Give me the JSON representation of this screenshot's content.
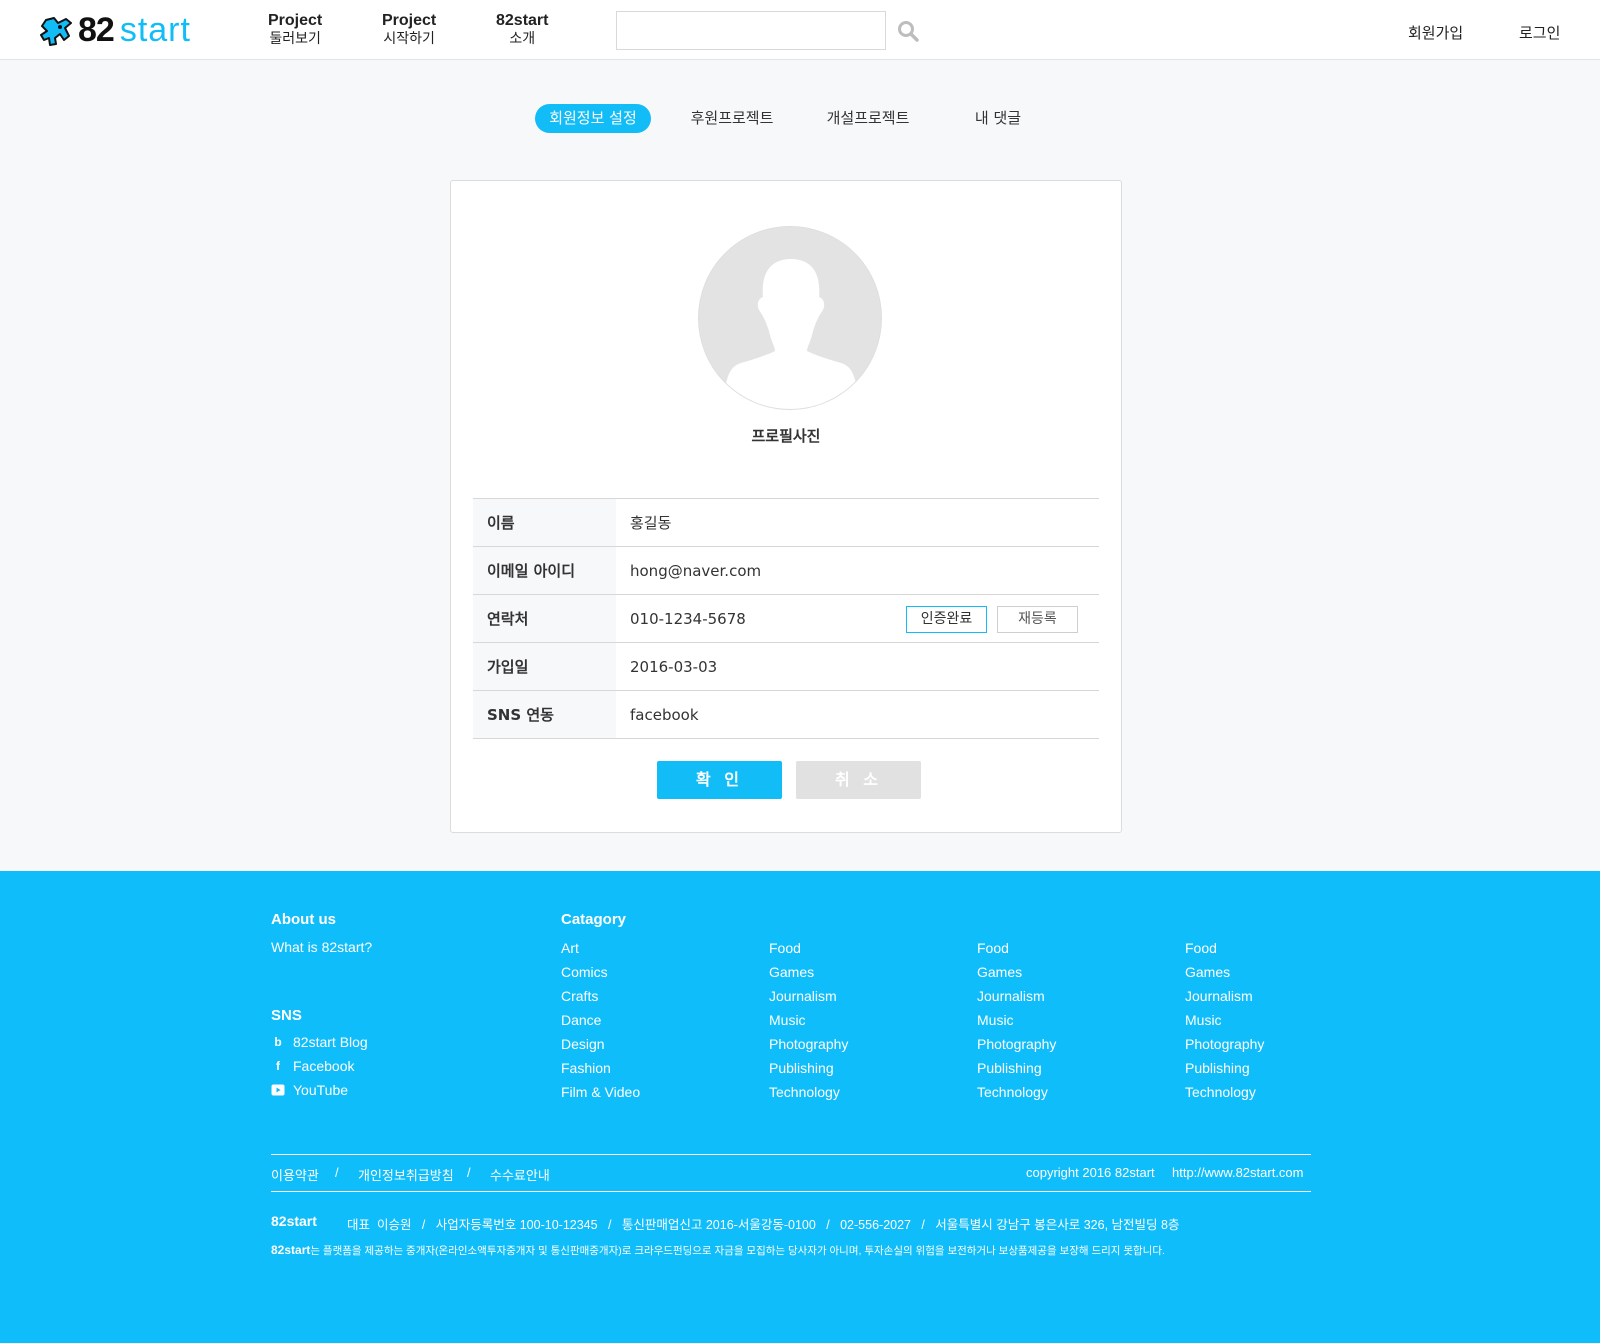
{
  "header": {
    "logo_number": "82",
    "logo_word": "start",
    "nav": [
      {
        "line1": "Project",
        "line2": "둘러보기"
      },
      {
        "line1": "Project",
        "line2": "시작하기"
      },
      {
        "line1": "82start",
        "line2": "소개"
      }
    ],
    "search_value": "",
    "signup": "회원가입",
    "login": "로그인"
  },
  "tabs": [
    "회원정보 설정",
    "후원프로젝트",
    "개설프로젝트",
    "내 댓글"
  ],
  "active_tab": 0,
  "profile": {
    "photo_label": "프로필사진",
    "rows": [
      {
        "label": "이름",
        "value": "홍길동"
      },
      {
        "label": "이메일 아이디",
        "value": "hong@naver.com"
      },
      {
        "label": "연락처",
        "value": "010-1234-5678"
      },
      {
        "label": "가입일",
        "value": "2016-03-03"
      },
      {
        "label": "SNS 연동",
        "value": "facebook"
      }
    ],
    "verify_button": "인증완료",
    "rereg_button": "재등록",
    "confirm_button": "확 인",
    "cancel_button": "취 소"
  },
  "footer": {
    "about_heading": "About us",
    "about_link": "What is 82start?",
    "sns_heading": "SNS",
    "sns": [
      {
        "icon": "blog-icon",
        "label": "82start Blog"
      },
      {
        "icon": "facebook-icon",
        "label": "Facebook"
      },
      {
        "icon": "youtube-icon",
        "label": "YouTube"
      }
    ],
    "category_heading": "Catagory",
    "category_col1": [
      "Art",
      "Comics",
      "Crafts",
      "Dance",
      "Design",
      "Fashion",
      "Film & Video"
    ],
    "category_col2": [
      "Food",
      "Games",
      "Journalism",
      "Music",
      "Photography",
      "Publishing",
      "Technology"
    ],
    "category_col3": [
      "Food",
      "Games",
      "Journalism",
      "Music",
      "Photography",
      "Publishing",
      "Technology"
    ],
    "category_col4": [
      "Food",
      "Games",
      "Journalism",
      "Music",
      "Photography",
      "Publishing",
      "Technology"
    ],
    "terms": "이용약관",
    "privacy": "개인정보취급방침",
    "fees": "수수료안내",
    "sep": "/",
    "copyright": "copyright 2016 82start",
    "site_url": "http://www.82start.com",
    "company_name": "82start",
    "company_info": "대표  이승원   /   사업자등록번호 100-10-12345   /   통신판매업신고 2016-서울강동-0100   /   02-556-2027   /   서울특별시 강남구 봉은사로 326, 남전빌딩 8층",
    "disclaimer_name": "82start",
    "disclaimer": "는 플랫폼을 제공하는 중개자(온라인소액투자중개자 및 통신판매중개자)로 크라우드펀딩으로 자금을 모집하는 당사자가 아니며, 투자손실의 위험을 보전하거나 보상품제공을 보장해 드리지 못합니다."
  },
  "colors": {
    "accent": "#12bdf7",
    "footer_bg": "#0fbdfa",
    "page_bg": "#f7f8fa"
  }
}
